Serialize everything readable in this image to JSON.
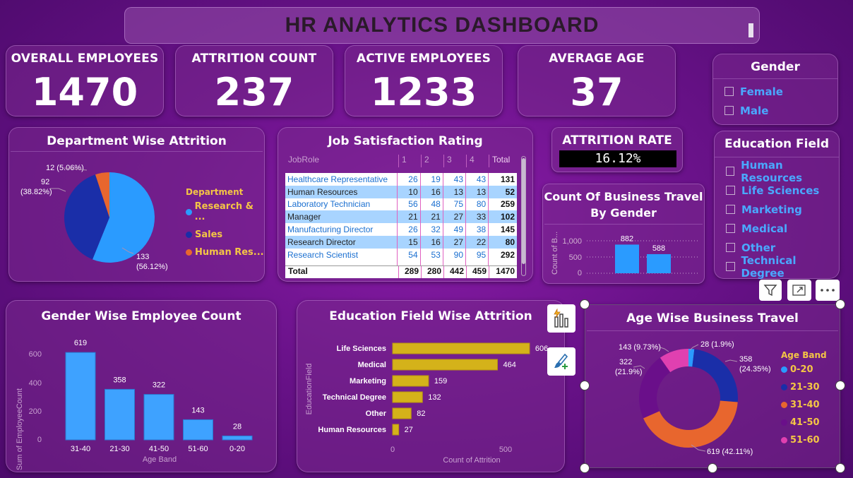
{
  "header": {
    "title": "HR ANALYTICS DASHBOARD"
  },
  "kpis": [
    {
      "label": "OVERALL EMPLOYEES",
      "value": "1470"
    },
    {
      "label": "ATTRITION COUNT",
      "value": "237"
    },
    {
      "label": "ACTIVE EMPLOYEES",
      "value": "1233"
    },
    {
      "label": "AVERAGE AGE",
      "value": "37"
    }
  ],
  "attrition_rate": {
    "label": "ATTRITION RATE",
    "value": "16.12%"
  },
  "gender_slicer": {
    "title": "Gender",
    "items": [
      "Female",
      "Male"
    ]
  },
  "education_slicer": {
    "title": "Education Field",
    "items": [
      "Human Resources",
      "Life Sciences",
      "Marketing",
      "Medical",
      "Other",
      "Technical Degree"
    ]
  },
  "dept_attrition": {
    "title": "Department Wise Attrition",
    "legend_title": "Department",
    "legend": [
      "Research & ...",
      "Sales",
      "Human Res..."
    ],
    "labels": {
      "hr": "12 (5.06%)",
      "sales_a": "92",
      "sales_b": "(38.82%)",
      "rd_a": "133",
      "rd_b": "(56.12%)"
    }
  },
  "job_satisfaction": {
    "title": "Job Satisfaction Rating",
    "headers": [
      "JobRole",
      "1",
      "2",
      "3",
      "4",
      "Total"
    ],
    "rows": [
      [
        "Healthcare Representative",
        "26",
        "19",
        "43",
        "43",
        "131"
      ],
      [
        "Human Resources",
        "10",
        "16",
        "13",
        "13",
        "52"
      ],
      [
        "Laboratory Technician",
        "56",
        "48",
        "75",
        "80",
        "259"
      ],
      [
        "Manager",
        "21",
        "21",
        "27",
        "33",
        "102"
      ],
      [
        "Manufacturing Director",
        "26",
        "32",
        "49",
        "38",
        "145"
      ],
      [
        "Research Director",
        "15",
        "16",
        "27",
        "22",
        "80"
      ],
      [
        "Research Scientist",
        "54",
        "53",
        "90",
        "95",
        "292"
      ]
    ],
    "total": [
      "Total",
      "289",
      "280",
      "442",
      "459",
      "1470"
    ]
  },
  "business_travel_gender": {
    "title_line1": "Count Of Business Travel",
    "title_line2": "By Gender",
    "ylabel": "Count of B...",
    "yticks": [
      "1,000",
      "500",
      "0"
    ],
    "values": [
      "882",
      "588"
    ]
  },
  "gender_employee": {
    "title": "Gender Wise Employee Count",
    "ylabel": "Sum of EmployeeCount",
    "xlabel": "Age Band",
    "yticks": [
      "600",
      "400",
      "200",
      "0"
    ]
  },
  "education_attrition": {
    "title": "Education Field Wise Attrition",
    "ylabel": "EducationField",
    "xlabel": "Count of Attrition",
    "xticks": [
      "0",
      "500"
    ]
  },
  "age_travel": {
    "title": "Age Wise Business Travel",
    "legend_title": "Age Band",
    "legend": [
      "0-20",
      "21-30",
      "31-40",
      "41-50",
      "51-60"
    ],
    "labels": {
      "a": "28 (1.9%)",
      "b1": "358",
      "b2": "(24.35%)",
      "c": "619 (42.11%)",
      "d1": "322",
      "d2": "(21.9%)",
      "e": "143 (9.73%)"
    }
  },
  "icons": [
    "filter-icon",
    "focus-mode-icon",
    "more-options-icon",
    "quick-insights-icon",
    "format-paint-icon"
  ],
  "colors": {
    "blue": "#2a9bff",
    "navy": "#1a2ea8",
    "orange": "#e8662e",
    "purple": "#6a0f8a",
    "pink": "#e040b0",
    "gold": "#d4b21a"
  },
  "chart_data": [
    {
      "type": "pie",
      "title": "Department Wise Attrition",
      "categories": [
        "Research & Development",
        "Sales",
        "Human Resources"
      ],
      "values": [
        133,
        92,
        12
      ],
      "legend_labels": [
        "Research & ...",
        "Sales",
        "Human Res..."
      ],
      "legend": "right"
    },
    {
      "type": "bar",
      "title": "Count Of Business Travel By Gender",
      "categories": [
        "",
        ""
      ],
      "values": [
        882,
        588
      ],
      "ylim": [
        0,
        1000
      ]
    },
    {
      "type": "bar",
      "title": "Gender Wise Employee Count",
      "categories": [
        "31-40",
        "21-30",
        "41-50",
        "51-60",
        "0-20"
      ],
      "values": [
        619,
        358,
        322,
        143,
        28
      ],
      "xlabel": "Age Band",
      "ylabel": "Sum of EmployeeCount",
      "ylim": [
        0,
        700
      ]
    },
    {
      "type": "bar",
      "orientation": "horizontal",
      "title": "Education Field Wise Attrition",
      "categories": [
        "Life Sciences",
        "Medical",
        "Marketing",
        "Technical Degree",
        "Other",
        "Human Resources"
      ],
      "values": [
        606,
        464,
        159,
        132,
        82,
        27
      ],
      "xlabel": "Count of Attrition",
      "ylabel": "EducationField",
      "xlim": [
        0,
        700
      ]
    },
    {
      "type": "pie",
      "title": "Age Wise Business Travel",
      "categories": [
        "0-20",
        "21-30",
        "31-40",
        "41-50",
        "51-60"
      ],
      "values": [
        28,
        358,
        619,
        322,
        143
      ],
      "legend": "right"
    }
  ]
}
